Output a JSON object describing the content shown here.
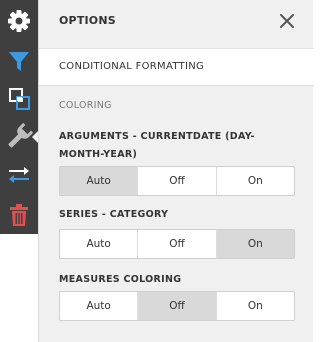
{
  "toolbar": {
    "items": [
      {
        "icon": "gear-icon",
        "color": "#ffffff"
      },
      {
        "icon": "filter-icon",
        "color": "#3b9ae1"
      },
      {
        "icon": "layers-icon",
        "color": "#ffffff"
      },
      {
        "icon": "wrench-icon",
        "color": "#bdbdbd",
        "active": true
      },
      {
        "icon": "swap-arrows-icon",
        "color": "#3b9ae1"
      },
      {
        "icon": "trash-icon",
        "color": "#e05050"
      }
    ]
  },
  "panel": {
    "title": "OPTIONS",
    "close_icon": "close-icon",
    "section": "CONDITIONAL FORMATTING",
    "group": "COLORING",
    "fields": [
      {
        "label": "ARGUMENTS - CURRENTDATE (DAY-MONTH-YEAR)",
        "options": [
          "Auto",
          "Off",
          "On"
        ],
        "selected": "Auto"
      },
      {
        "label": "SERIES - CATEGORY",
        "options": [
          "Auto",
          "Off",
          "On"
        ],
        "selected": "On"
      },
      {
        "label": "MEASURES COLORING",
        "options": [
          "Auto",
          "Off",
          "On"
        ],
        "selected": "Off"
      }
    ]
  }
}
